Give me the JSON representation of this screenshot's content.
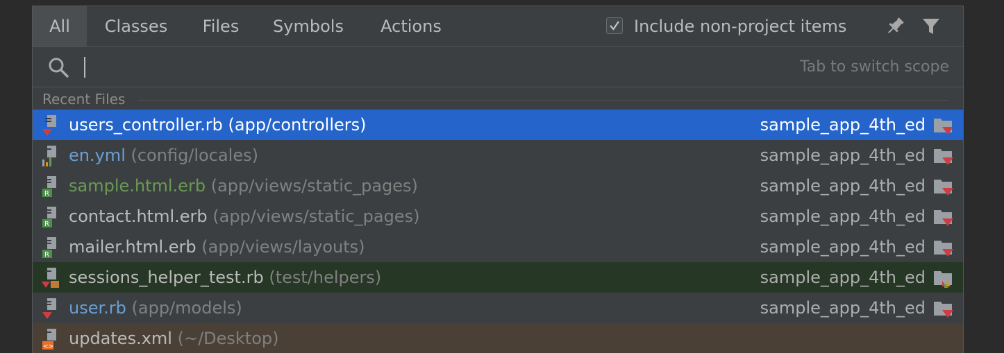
{
  "tabs": [
    {
      "label": "All",
      "active": true
    },
    {
      "label": "Classes",
      "active": false
    },
    {
      "label": "Files",
      "active": false
    },
    {
      "label": "Symbols",
      "active": false
    },
    {
      "label": "Actions",
      "active": false
    }
  ],
  "options": {
    "include_non_project_label": "Include non-project items",
    "include_non_project_checked": true,
    "pin_icon": "pin-icon",
    "filter_icon": "filter-icon"
  },
  "search": {
    "value": "",
    "placeholder": "",
    "hint": "Tab to switch scope",
    "icon": "search-icon"
  },
  "section": {
    "title": "Recent Files"
  },
  "rows": [
    {
      "name": "users_controller.rb",
      "path": "(app/controllers)",
      "project": "sample_app_4th_ed",
      "icon": "ruby-file-icon",
      "name_color": "#ffffff",
      "state": "selected"
    },
    {
      "name": "en.yml",
      "path": "(config/locales)",
      "project": "sample_app_4th_ed",
      "icon": "yaml-file-icon",
      "name_color": "#6a9fd6",
      "state": "normal"
    },
    {
      "name": "sample.html.erb",
      "path": "(app/views/static_pages)",
      "project": "sample_app_4th_ed",
      "icon": "erb-file-icon",
      "name_color": "#6a9955",
      "state": "normal"
    },
    {
      "name": "contact.html.erb",
      "path": "(app/views/static_pages)",
      "project": "sample_app_4th_ed",
      "icon": "erb-file-icon",
      "name_color": "#bbbbbb",
      "state": "normal"
    },
    {
      "name": "mailer.html.erb",
      "path": "(app/views/layouts)",
      "project": "sample_app_4th_ed",
      "icon": "erb-file-icon",
      "name_color": "#bbbbbb",
      "state": "normal"
    },
    {
      "name": "sessions_helper_test.rb",
      "path": "(test/helpers)",
      "project": "sample_app_4th_ed",
      "icon": "ruby-test-file-icon",
      "name_color": "#bbbbbb",
      "state": "test"
    },
    {
      "name": "user.rb",
      "path": "(app/models)",
      "project": "sample_app_4th_ed",
      "icon": "ruby-file-icon",
      "name_color": "#6a9fd6",
      "state": "normal"
    },
    {
      "name": "updates.xml",
      "path": "(~/Desktop)",
      "project": "",
      "icon": "xml-file-icon",
      "name_color": "#bbbbbb",
      "state": "external"
    }
  ],
  "colors": {
    "selection": "#2464cb",
    "test_row": "#263726",
    "external_row": "#4a4035",
    "ruby_red": "#cc3e44"
  }
}
